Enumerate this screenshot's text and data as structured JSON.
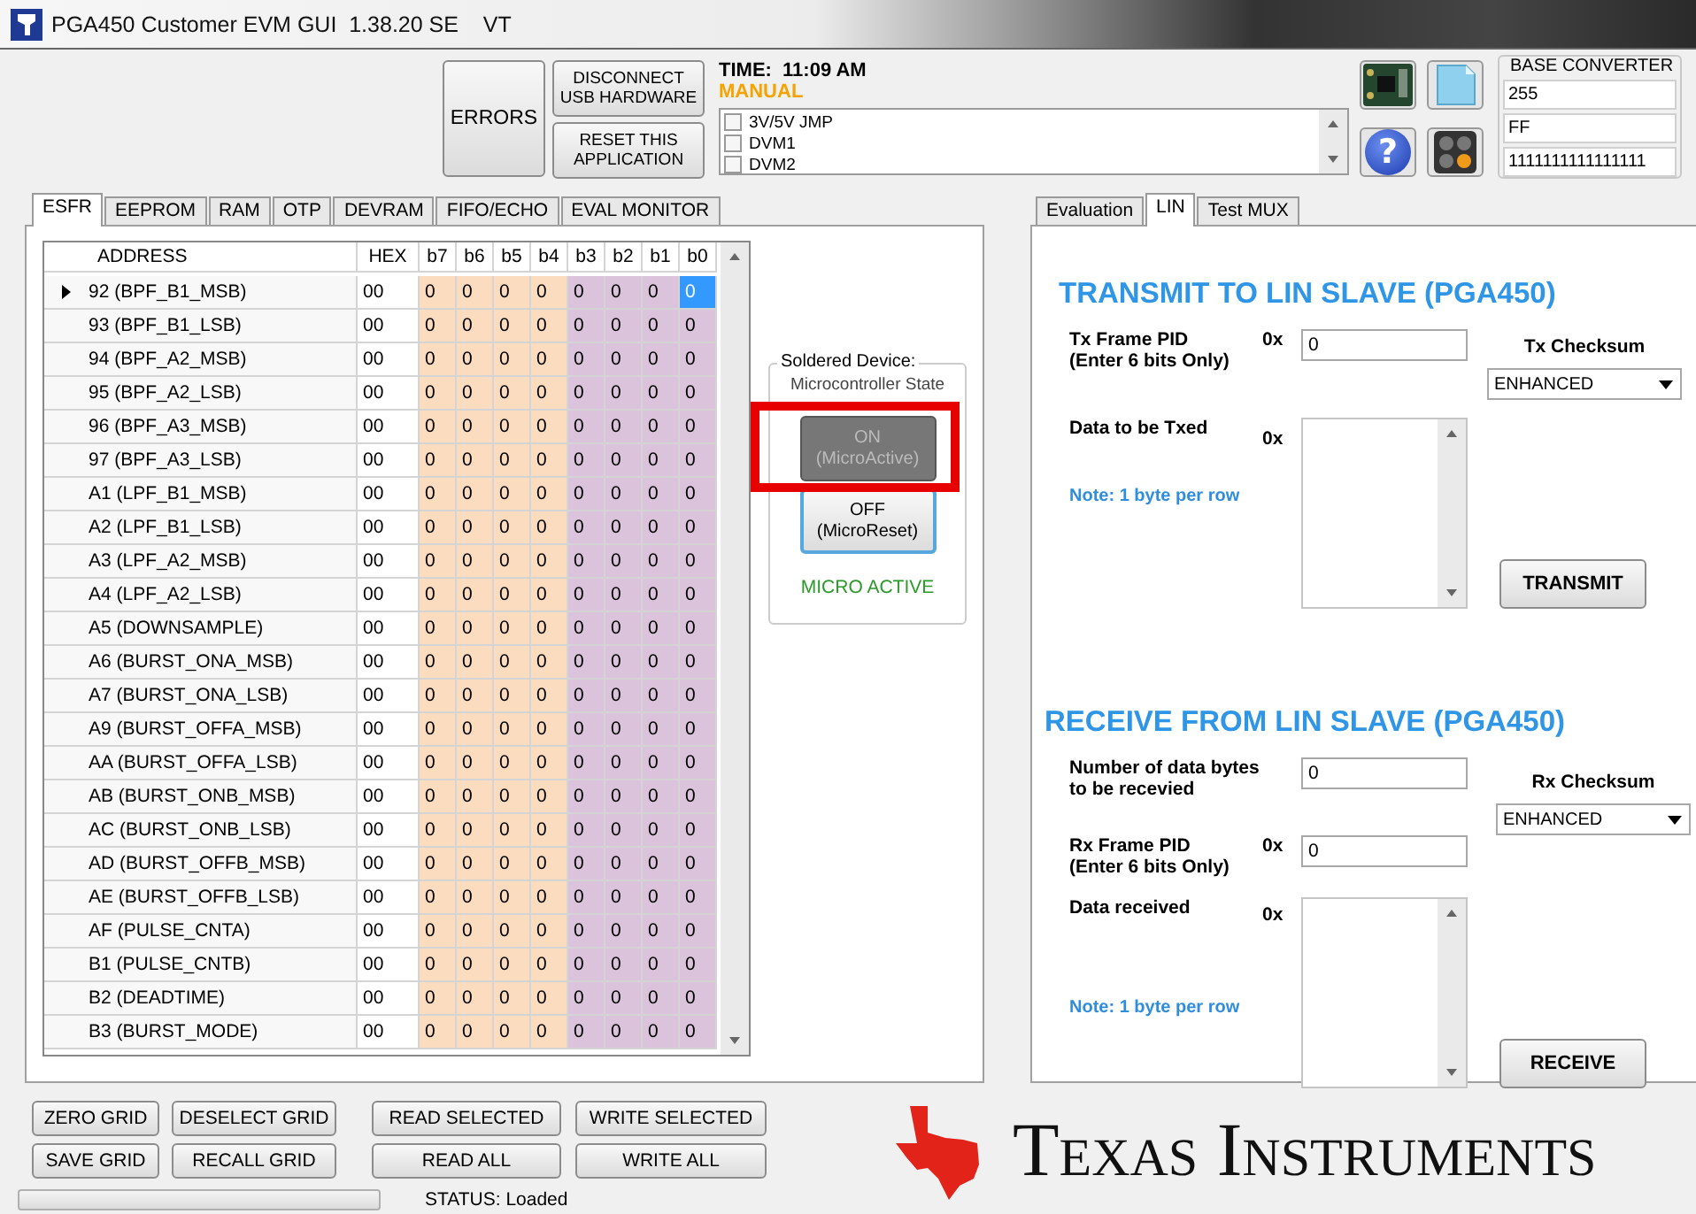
{
  "window": {
    "title": "PGA450 Customer EVM GUI  1.38.20 SE    VT"
  },
  "toolbar": {
    "errors": "ERRORS",
    "buttons": [
      [
        "DISCONNECT",
        "USB HARDWARE"
      ],
      [
        "RESET THIS",
        "APPLICATION"
      ]
    ],
    "time": "TIME:  11:09 AM",
    "mode": "MANUAL",
    "checks": [
      {
        "label": "3V/5V JMP",
        "checked": false
      },
      {
        "label": "DVM1",
        "checked": false
      },
      {
        "label": "DVM2",
        "checked": false
      }
    ],
    "icons": [
      {
        "kind": "board"
      },
      {
        "kind": "notepad"
      },
      {
        "kind": "help",
        "label": "?"
      },
      {
        "kind": "calculator"
      }
    ],
    "base_converter": {
      "title": "BASE CONVERTER",
      "values": [
        "255",
        "FF",
        "1111111111111111"
      ]
    }
  },
  "left_tabs": [
    {
      "label": "ESFR",
      "selected": true
    },
    {
      "label": "EEPROM",
      "selected": false
    },
    {
      "label": "RAM",
      "selected": false
    },
    {
      "label": "OTP",
      "selected": false
    },
    {
      "label": "DEVRAM",
      "selected": false
    },
    {
      "label": "FIFO/ECHO",
      "selected": false
    },
    {
      "label": "EVAL MONITOR",
      "selected": false
    }
  ],
  "grid": {
    "columns": [
      "ADDRESS",
      "HEX",
      "b7",
      "b6",
      "b5",
      "b4",
      "b3",
      "b2",
      "b1",
      "b0"
    ],
    "rows": [
      {
        "address": "92 (BPF_B1_MSB)",
        "hex": "00",
        "selected": true,
        "bits": [
          {
            "value": "0",
            "selected": false
          },
          {
            "value": "0",
            "selected": false
          },
          {
            "value": "0",
            "selected": false
          },
          {
            "value": "0",
            "selected": false
          },
          {
            "value": "0",
            "selected": false
          },
          {
            "value": "0",
            "selected": false
          },
          {
            "value": "0",
            "selected": false
          },
          {
            "value": "0",
            "selected": true
          }
        ]
      },
      {
        "address": "93 (BPF_B1_LSB)",
        "hex": "00",
        "selected": false,
        "bits": [
          {
            "value": "0",
            "selected": false
          },
          {
            "value": "0",
            "selected": false
          },
          {
            "value": "0",
            "selected": false
          },
          {
            "value": "0",
            "selected": false
          },
          {
            "value": "0",
            "selected": false
          },
          {
            "value": "0",
            "selected": false
          },
          {
            "value": "0",
            "selected": false
          },
          {
            "value": "0",
            "selected": false
          }
        ]
      },
      {
        "address": "94 (BPF_A2_MSB)",
        "hex": "00",
        "selected": false,
        "bits": [
          {
            "value": "0",
            "selected": false
          },
          {
            "value": "0",
            "selected": false
          },
          {
            "value": "0",
            "selected": false
          },
          {
            "value": "0",
            "selected": false
          },
          {
            "value": "0",
            "selected": false
          },
          {
            "value": "0",
            "selected": false
          },
          {
            "value": "0",
            "selected": false
          },
          {
            "value": "0",
            "selected": false
          }
        ]
      },
      {
        "address": "95 (BPF_A2_LSB)",
        "hex": "00",
        "selected": false,
        "bits": [
          {
            "value": "0",
            "selected": false
          },
          {
            "value": "0",
            "selected": false
          },
          {
            "value": "0",
            "selected": false
          },
          {
            "value": "0",
            "selected": false
          },
          {
            "value": "0",
            "selected": false
          },
          {
            "value": "0",
            "selected": false
          },
          {
            "value": "0",
            "selected": false
          },
          {
            "value": "0",
            "selected": false
          }
        ]
      },
      {
        "address": "96 (BPF_A3_MSB)",
        "hex": "00",
        "selected": false,
        "bits": [
          {
            "value": "0",
            "selected": false
          },
          {
            "value": "0",
            "selected": false
          },
          {
            "value": "0",
            "selected": false
          },
          {
            "value": "0",
            "selected": false
          },
          {
            "value": "0",
            "selected": false
          },
          {
            "value": "0",
            "selected": false
          },
          {
            "value": "0",
            "selected": false
          },
          {
            "value": "0",
            "selected": false
          }
        ]
      },
      {
        "address": "97 (BPF_A3_LSB)",
        "hex": "00",
        "selected": false,
        "bits": [
          {
            "value": "0",
            "selected": false
          },
          {
            "value": "0",
            "selected": false
          },
          {
            "value": "0",
            "selected": false
          },
          {
            "value": "0",
            "selected": false
          },
          {
            "value": "0",
            "selected": false
          },
          {
            "value": "0",
            "selected": false
          },
          {
            "value": "0",
            "selected": false
          },
          {
            "value": "0",
            "selected": false
          }
        ]
      },
      {
        "address": "A1 (LPF_B1_MSB)",
        "hex": "00",
        "selected": false,
        "bits": [
          {
            "value": "0",
            "selected": false
          },
          {
            "value": "0",
            "selected": false
          },
          {
            "value": "0",
            "selected": false
          },
          {
            "value": "0",
            "selected": false
          },
          {
            "value": "0",
            "selected": false
          },
          {
            "value": "0",
            "selected": false
          },
          {
            "value": "0",
            "selected": false
          },
          {
            "value": "0",
            "selected": false
          }
        ]
      },
      {
        "address": "A2 (LPF_B1_LSB)",
        "hex": "00",
        "selected": false,
        "bits": [
          {
            "value": "0",
            "selected": false
          },
          {
            "value": "0",
            "selected": false
          },
          {
            "value": "0",
            "selected": false
          },
          {
            "value": "0",
            "selected": false
          },
          {
            "value": "0",
            "selected": false
          },
          {
            "value": "0",
            "selected": false
          },
          {
            "value": "0",
            "selected": false
          },
          {
            "value": "0",
            "selected": false
          }
        ]
      },
      {
        "address": "A3 (LPF_A2_MSB)",
        "hex": "00",
        "selected": false,
        "bits": [
          {
            "value": "0",
            "selected": false
          },
          {
            "value": "0",
            "selected": false
          },
          {
            "value": "0",
            "selected": false
          },
          {
            "value": "0",
            "selected": false
          },
          {
            "value": "0",
            "selected": false
          },
          {
            "value": "0",
            "selected": false
          },
          {
            "value": "0",
            "selected": false
          },
          {
            "value": "0",
            "selected": false
          }
        ]
      },
      {
        "address": "A4 (LPF_A2_LSB)",
        "hex": "00",
        "selected": false,
        "bits": [
          {
            "value": "0",
            "selected": false
          },
          {
            "value": "0",
            "selected": false
          },
          {
            "value": "0",
            "selected": false
          },
          {
            "value": "0",
            "selected": false
          },
          {
            "value": "0",
            "selected": false
          },
          {
            "value": "0",
            "selected": false
          },
          {
            "value": "0",
            "selected": false
          },
          {
            "value": "0",
            "selected": false
          }
        ]
      },
      {
        "address": "A5 (DOWNSAMPLE)",
        "hex": "00",
        "selected": false,
        "bits": [
          {
            "value": "0",
            "selected": false
          },
          {
            "value": "0",
            "selected": false
          },
          {
            "value": "0",
            "selected": false
          },
          {
            "value": "0",
            "selected": false
          },
          {
            "value": "0",
            "selected": false
          },
          {
            "value": "0",
            "selected": false
          },
          {
            "value": "0",
            "selected": false
          },
          {
            "value": "0",
            "selected": false
          }
        ]
      },
      {
        "address": "A6 (BURST_ONA_MSB)",
        "hex": "00",
        "selected": false,
        "bits": [
          {
            "value": "0",
            "selected": false
          },
          {
            "value": "0",
            "selected": false
          },
          {
            "value": "0",
            "selected": false
          },
          {
            "value": "0",
            "selected": false
          },
          {
            "value": "0",
            "selected": false
          },
          {
            "value": "0",
            "selected": false
          },
          {
            "value": "0",
            "selected": false
          },
          {
            "value": "0",
            "selected": false
          }
        ]
      },
      {
        "address": "A7 (BURST_ONA_LSB)",
        "hex": "00",
        "selected": false,
        "bits": [
          {
            "value": "0",
            "selected": false
          },
          {
            "value": "0",
            "selected": false
          },
          {
            "value": "0",
            "selected": false
          },
          {
            "value": "0",
            "selected": false
          },
          {
            "value": "0",
            "selected": false
          },
          {
            "value": "0",
            "selected": false
          },
          {
            "value": "0",
            "selected": false
          },
          {
            "value": "0",
            "selected": false
          }
        ]
      },
      {
        "address": "A9 (BURST_OFFA_MSB)",
        "hex": "00",
        "selected": false,
        "bits": [
          {
            "value": "0",
            "selected": false
          },
          {
            "value": "0",
            "selected": false
          },
          {
            "value": "0",
            "selected": false
          },
          {
            "value": "0",
            "selected": false
          },
          {
            "value": "0",
            "selected": false
          },
          {
            "value": "0",
            "selected": false
          },
          {
            "value": "0",
            "selected": false
          },
          {
            "value": "0",
            "selected": false
          }
        ]
      },
      {
        "address": "AA (BURST_OFFA_LSB)",
        "hex": "00",
        "selected": false,
        "bits": [
          {
            "value": "0",
            "selected": false
          },
          {
            "value": "0",
            "selected": false
          },
          {
            "value": "0",
            "selected": false
          },
          {
            "value": "0",
            "selected": false
          },
          {
            "value": "0",
            "selected": false
          },
          {
            "value": "0",
            "selected": false
          },
          {
            "value": "0",
            "selected": false
          },
          {
            "value": "0",
            "selected": false
          }
        ]
      },
      {
        "address": "AB (BURST_ONB_MSB)",
        "hex": "00",
        "selected": false,
        "bits": [
          {
            "value": "0",
            "selected": false
          },
          {
            "value": "0",
            "selected": false
          },
          {
            "value": "0",
            "selected": false
          },
          {
            "value": "0",
            "selected": false
          },
          {
            "value": "0",
            "selected": false
          },
          {
            "value": "0",
            "selected": false
          },
          {
            "value": "0",
            "selected": false
          },
          {
            "value": "0",
            "selected": false
          }
        ]
      },
      {
        "address": "AC (BURST_ONB_LSB)",
        "hex": "00",
        "selected": false,
        "bits": [
          {
            "value": "0",
            "selected": false
          },
          {
            "value": "0",
            "selected": false
          },
          {
            "value": "0",
            "selected": false
          },
          {
            "value": "0",
            "selected": false
          },
          {
            "value": "0",
            "selected": false
          },
          {
            "value": "0",
            "selected": false
          },
          {
            "value": "0",
            "selected": false
          },
          {
            "value": "0",
            "selected": false
          }
        ]
      },
      {
        "address": "AD (BURST_OFFB_MSB)",
        "hex": "00",
        "selected": false,
        "bits": [
          {
            "value": "0",
            "selected": false
          },
          {
            "value": "0",
            "selected": false
          },
          {
            "value": "0",
            "selected": false
          },
          {
            "value": "0",
            "selected": false
          },
          {
            "value": "0",
            "selected": false
          },
          {
            "value": "0",
            "selected": false
          },
          {
            "value": "0",
            "selected": false
          },
          {
            "value": "0",
            "selected": false
          }
        ]
      },
      {
        "address": "AE (BURST_OFFB_LSB)",
        "hex": "00",
        "selected": false,
        "bits": [
          {
            "value": "0",
            "selected": false
          },
          {
            "value": "0",
            "selected": false
          },
          {
            "value": "0",
            "selected": false
          },
          {
            "value": "0",
            "selected": false
          },
          {
            "value": "0",
            "selected": false
          },
          {
            "value": "0",
            "selected": false
          },
          {
            "value": "0",
            "selected": false
          },
          {
            "value": "0",
            "selected": false
          }
        ]
      },
      {
        "address": "AF (PULSE_CNTA)",
        "hex": "00",
        "selected": false,
        "bits": [
          {
            "value": "0",
            "selected": false
          },
          {
            "value": "0",
            "selected": false
          },
          {
            "value": "0",
            "selected": false
          },
          {
            "value": "0",
            "selected": false
          },
          {
            "value": "0",
            "selected": false
          },
          {
            "value": "0",
            "selected": false
          },
          {
            "value": "0",
            "selected": false
          },
          {
            "value": "0",
            "selected": false
          }
        ]
      },
      {
        "address": "B1 (PULSE_CNTB)",
        "hex": "00",
        "selected": false,
        "bits": [
          {
            "value": "0",
            "selected": false
          },
          {
            "value": "0",
            "selected": false
          },
          {
            "value": "0",
            "selected": false
          },
          {
            "value": "0",
            "selected": false
          },
          {
            "value": "0",
            "selected": false
          },
          {
            "value": "0",
            "selected": false
          },
          {
            "value": "0",
            "selected": false
          },
          {
            "value": "0",
            "selected": false
          }
        ]
      },
      {
        "address": "B2 (DEADTIME)",
        "hex": "00",
        "selected": false,
        "bits": [
          {
            "value": "0",
            "selected": false
          },
          {
            "value": "0",
            "selected": false
          },
          {
            "value": "0",
            "selected": false
          },
          {
            "value": "0",
            "selected": false
          },
          {
            "value": "0",
            "selected": false
          },
          {
            "value": "0",
            "selected": false
          },
          {
            "value": "0",
            "selected": false
          },
          {
            "value": "0",
            "selected": false
          }
        ]
      },
      {
        "address": "B3 (BURST_MODE)",
        "hex": "00",
        "selected": false,
        "bits": [
          {
            "value": "0",
            "selected": false
          },
          {
            "value": "0",
            "selected": false
          },
          {
            "value": "0",
            "selected": false
          },
          {
            "value": "0",
            "selected": false
          },
          {
            "value": "0",
            "selected": false
          },
          {
            "value": "0",
            "selected": false
          },
          {
            "value": "0",
            "selected": false
          },
          {
            "value": "0",
            "selected": false
          }
        ]
      }
    ]
  },
  "micro": {
    "title": "Soldered Device:",
    "subtitle": "Microcontroller State",
    "buttons": [
      {
        "lines": [
          "ON",
          "(MicroActive)"
        ],
        "pressed": true,
        "highlighted": true
      },
      {
        "lines": [
          "OFF",
          "(MicroReset)"
        ],
        "pressed": false,
        "highlighted": false
      }
    ],
    "status": "MICRO ACTIVE"
  },
  "right_tabs": [
    {
      "label": "Evaluation",
      "selected": false
    },
    {
      "label": "LIN",
      "selected": true
    },
    {
      "label": "Test MUX",
      "selected": false
    }
  ],
  "lin": {
    "transmit": {
      "title": "TRANSMIT TO LIN SLAVE (PGA450)",
      "pid_label": [
        "Tx Frame PID",
        "(Enter 6 bits Only)"
      ],
      "pid_prefix": "0x",
      "pid_value": "0",
      "checksum_label": "Tx Checksum",
      "checksum": "ENHANCED",
      "data_label": "Data to be Txed",
      "data_prefix": "0x",
      "note": "Note: 1 byte per row",
      "button": "TRANSMIT"
    },
    "receive": {
      "title": "RECEIVE FROM LIN SLAVE (PGA450)",
      "count_label": [
        "Number of data bytes",
        "to be recevied"
      ],
      "count_value": "0",
      "checksum_label": "Rx Checksum",
      "checksum": "ENHANCED",
      "pid_label": [
        "Rx Frame PID",
        "(Enter 6 bits Only)"
      ],
      "pid_prefix": "0x",
      "pid_value": "0",
      "data_label": "Data received",
      "data_prefix": "0x",
      "note": "Note: 1 byte per row",
      "button": "RECEIVE"
    }
  },
  "bottom": {
    "buttons": [
      [
        "ZERO GRID",
        "DESELECT GRID",
        "READ SELECTED",
        "WRITE SELECTED"
      ],
      [
        "SAVE GRID",
        "RECALL GRID",
        "READ ALL",
        "WRITE ALL"
      ]
    ],
    "progress": {
      "level": 0
    },
    "status": "STATUS: Loaded",
    "logo": "Texas Instruments"
  }
}
